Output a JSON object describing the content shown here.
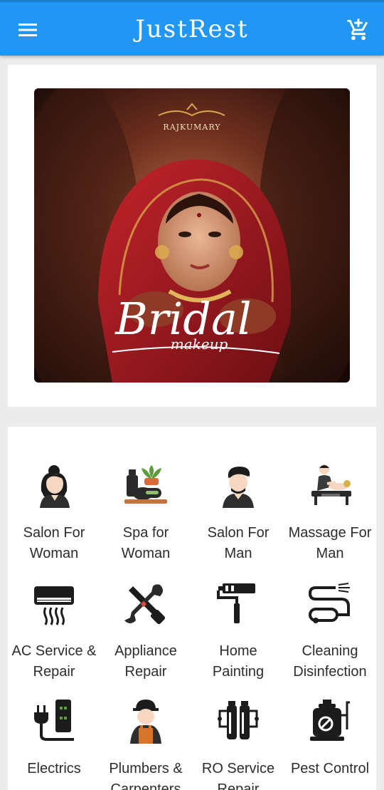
{
  "app": {
    "title": "JustRest",
    "icons": {
      "menu": "menu-icon",
      "cart": "add-to-cart-icon"
    },
    "accent": "#2196f3"
  },
  "banner": {
    "brand": "RAJKUMARY",
    "headline": "Bridal",
    "subline": "makeup"
  },
  "services": [
    {
      "label": "Salon For Woman",
      "icon": "woman-icon"
    },
    {
      "label": "Spa for Woman",
      "icon": "spa-icon"
    },
    {
      "label": "Salon For Man",
      "icon": "man-icon"
    },
    {
      "label": "Massage For Man",
      "icon": "massage-icon"
    },
    {
      "label": "AC Service & Repair",
      "icon": "air-conditioner-icon"
    },
    {
      "label": "Appliance Repair",
      "icon": "tools-icon"
    },
    {
      "label": "Home Painting",
      "icon": "paint-roller-icon"
    },
    {
      "label": "Cleaning Disinfection",
      "icon": "vacuum-cleaner-icon"
    },
    {
      "label": "Electrics",
      "icon": "electric-plug-icon"
    },
    {
      "label": "Plumbers & Carpenters",
      "icon": "plumber-icon"
    },
    {
      "label": "RO Service Repair",
      "icon": "water-filter-icon"
    },
    {
      "label": "Pest Control",
      "icon": "pest-sprayer-icon"
    }
  ]
}
